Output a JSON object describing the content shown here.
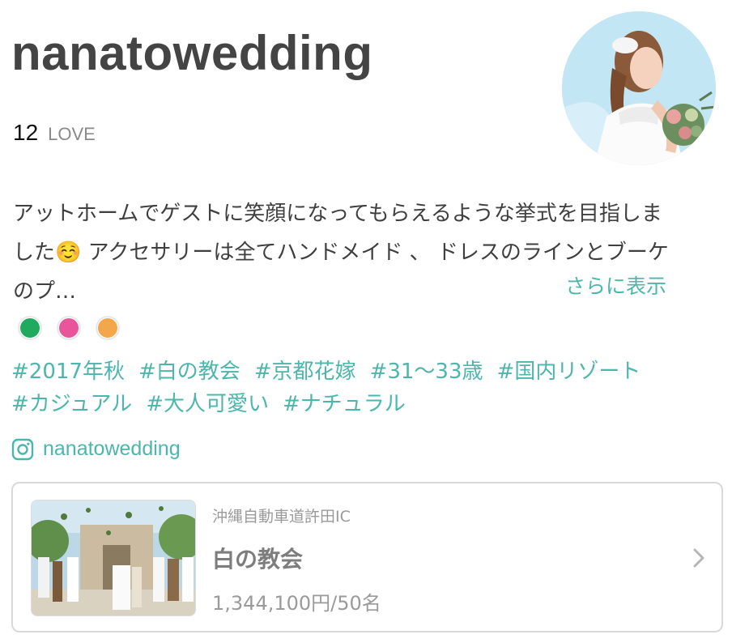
{
  "profile": {
    "username": "nanatowedding",
    "love_count": "12",
    "love_label": "LOVE",
    "avatar_alt": "avatar"
  },
  "bio": {
    "lines": [
      "アットホームでゲストに笑顔になってもらえるような挙式を目指しま",
      "した☺️  アクセサリーは全てハンドメイド 、 ドレスのラインとブーケ",
      "のプ…"
    ],
    "more_label": "さらに表示"
  },
  "colors": {
    "accent": "#4db6ac",
    "theme_dots": [
      "#1faa5f",
      "#e8559b",
      "#f4a64b"
    ]
  },
  "tags": {
    "row1": [
      "#2017年秋",
      "#白の教会",
      "#京都花嫁",
      "#31〜33歳",
      "#国内リゾート"
    ],
    "row2": [
      "#カジュアル",
      "#大人可愛い",
      "#ナチュラル"
    ]
  },
  "instagram": {
    "icon": "instagram-icon",
    "handle": "nanatowedding"
  },
  "venue": {
    "location": "沖縄自動車道許田IC",
    "name": "白の教会",
    "price": "1,344,100円/50名",
    "chevron_icon": "chevron-right-icon"
  }
}
